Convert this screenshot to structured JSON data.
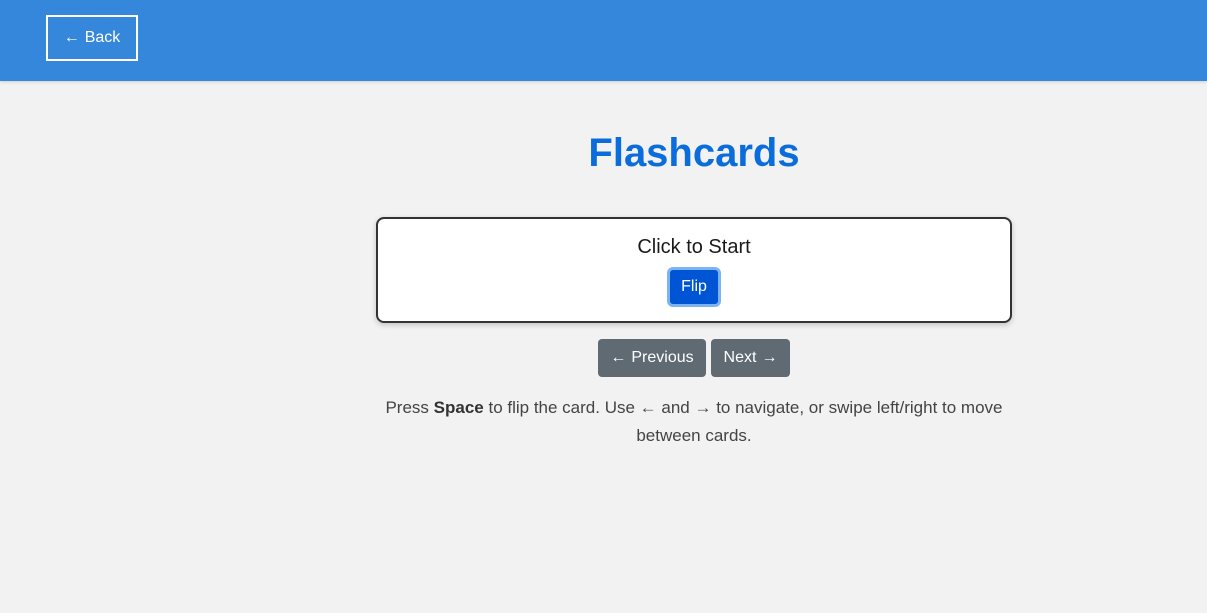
{
  "header": {
    "back_arrow": "←",
    "back_label": "Back"
  },
  "main": {
    "title": "Flashcards",
    "card": {
      "text": "Click to Start",
      "flip_label": "Flip"
    },
    "nav": {
      "prev_arrow": "←",
      "prev_label": "Previous",
      "next_label": "Next",
      "next_arrow": "→"
    },
    "instructions": {
      "part1": "Press ",
      "key": "Space",
      "part2": " to flip the card. Use ",
      "left_arrow": "←",
      "part3": " and ",
      "right_arrow": "→",
      "part4": " to navigate, or swipe left/right to move between cards."
    }
  },
  "colors": {
    "header_bg": "#3587dc",
    "title": "#0b6ddb",
    "flip_button": "#0055d4",
    "nav_button": "#5f6a73",
    "page_bg": "#f2f2f2"
  }
}
